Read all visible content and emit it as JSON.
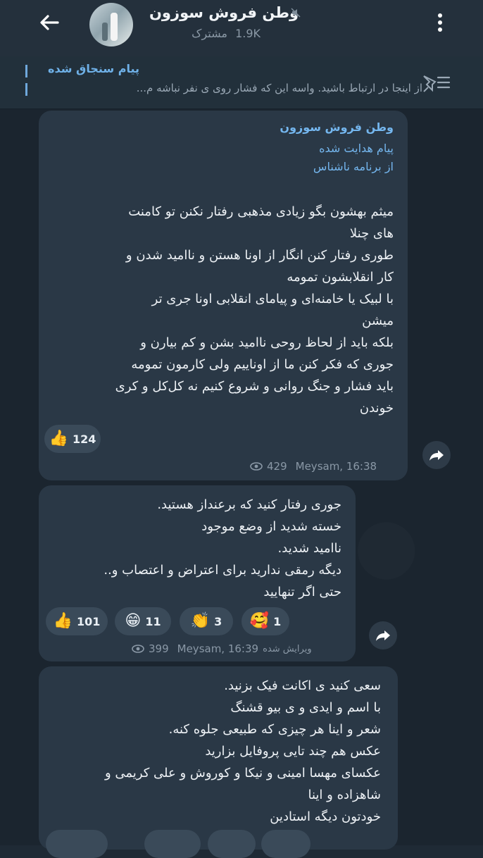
{
  "header": {
    "title": "وطن فروش سوزون",
    "subscriber_count": "1.9K",
    "subscriber_label": "مشترک"
  },
  "pinned": {
    "title": "پیام سنجاق شده",
    "text": "از اینجا در ارتباط باشید.  واسه این که فشار روی ی نفر نباشه  م..."
  },
  "messages": [
    {
      "forwarded_from": "وطن فروش سوزون",
      "forward_line1": "پیام هدایت شده",
      "forward_line2": "از برنامه ناشناس",
      "text": "میثم بهشون بگو زیادی مذهبی رفتار نکنن تو کامنت\nهای چنلا\nطوری رفتار کنن انگار از اونا هستن و ناامید شدن و\nکار انقلابشون تمومه\nبا لبیک یا خامنه‌ای و پیامای انقلابی اونا جری تر\nمیشن\nبلکه باید از لحاظ روحی ناامید بشن و کم بیارن و\nجوری که فکر کنن ما از اوناییم ولی کارمون تمومه\nباید فشار و جنگ روانی و شروع کنیم نه کل‌کل و کری\nخوندن",
      "reactions": [
        {
          "emoji": "👍",
          "count": "124"
        }
      ],
      "views": "429",
      "author_time": "Meysam, 16:38"
    },
    {
      "text": "جوری رفتار کنید که برعنداز هستید.\nخسته شدید از وضع موجود\nناامید شدید.\nدیگه رمقی ندارید برای اعتراض و اعتصاب و..\nحتی اگر تنهایید",
      "reactions": [
        {
          "emoji": "👍",
          "count": "101"
        },
        {
          "emoji": "😁",
          "count": "11"
        },
        {
          "emoji": "👏",
          "count": "3"
        },
        {
          "emoji": "🥰",
          "count": "1"
        }
      ],
      "edited_label": "ویرایش شده",
      "views": "399",
      "author_time": "Meysam, 16:39"
    },
    {
      "text": "سعی کنید ی اکانت فیک بزنید.\nبا اسم و ایدی و ی بیو قشنگ\nشعر و اینا هر چیزی که طبیعی جلوه کنه.\nعکس هم چند تایی پروفایل بزارید\nعکسای مهسا امینی و نیکا و کوروش و علی کریمی و\nشاهزاده و اینا\nخودتون دیگه استادین"
    }
  ],
  "colors": {
    "background": "#1b252f",
    "bubble": "#2a3846",
    "accent": "#74b6ee"
  }
}
